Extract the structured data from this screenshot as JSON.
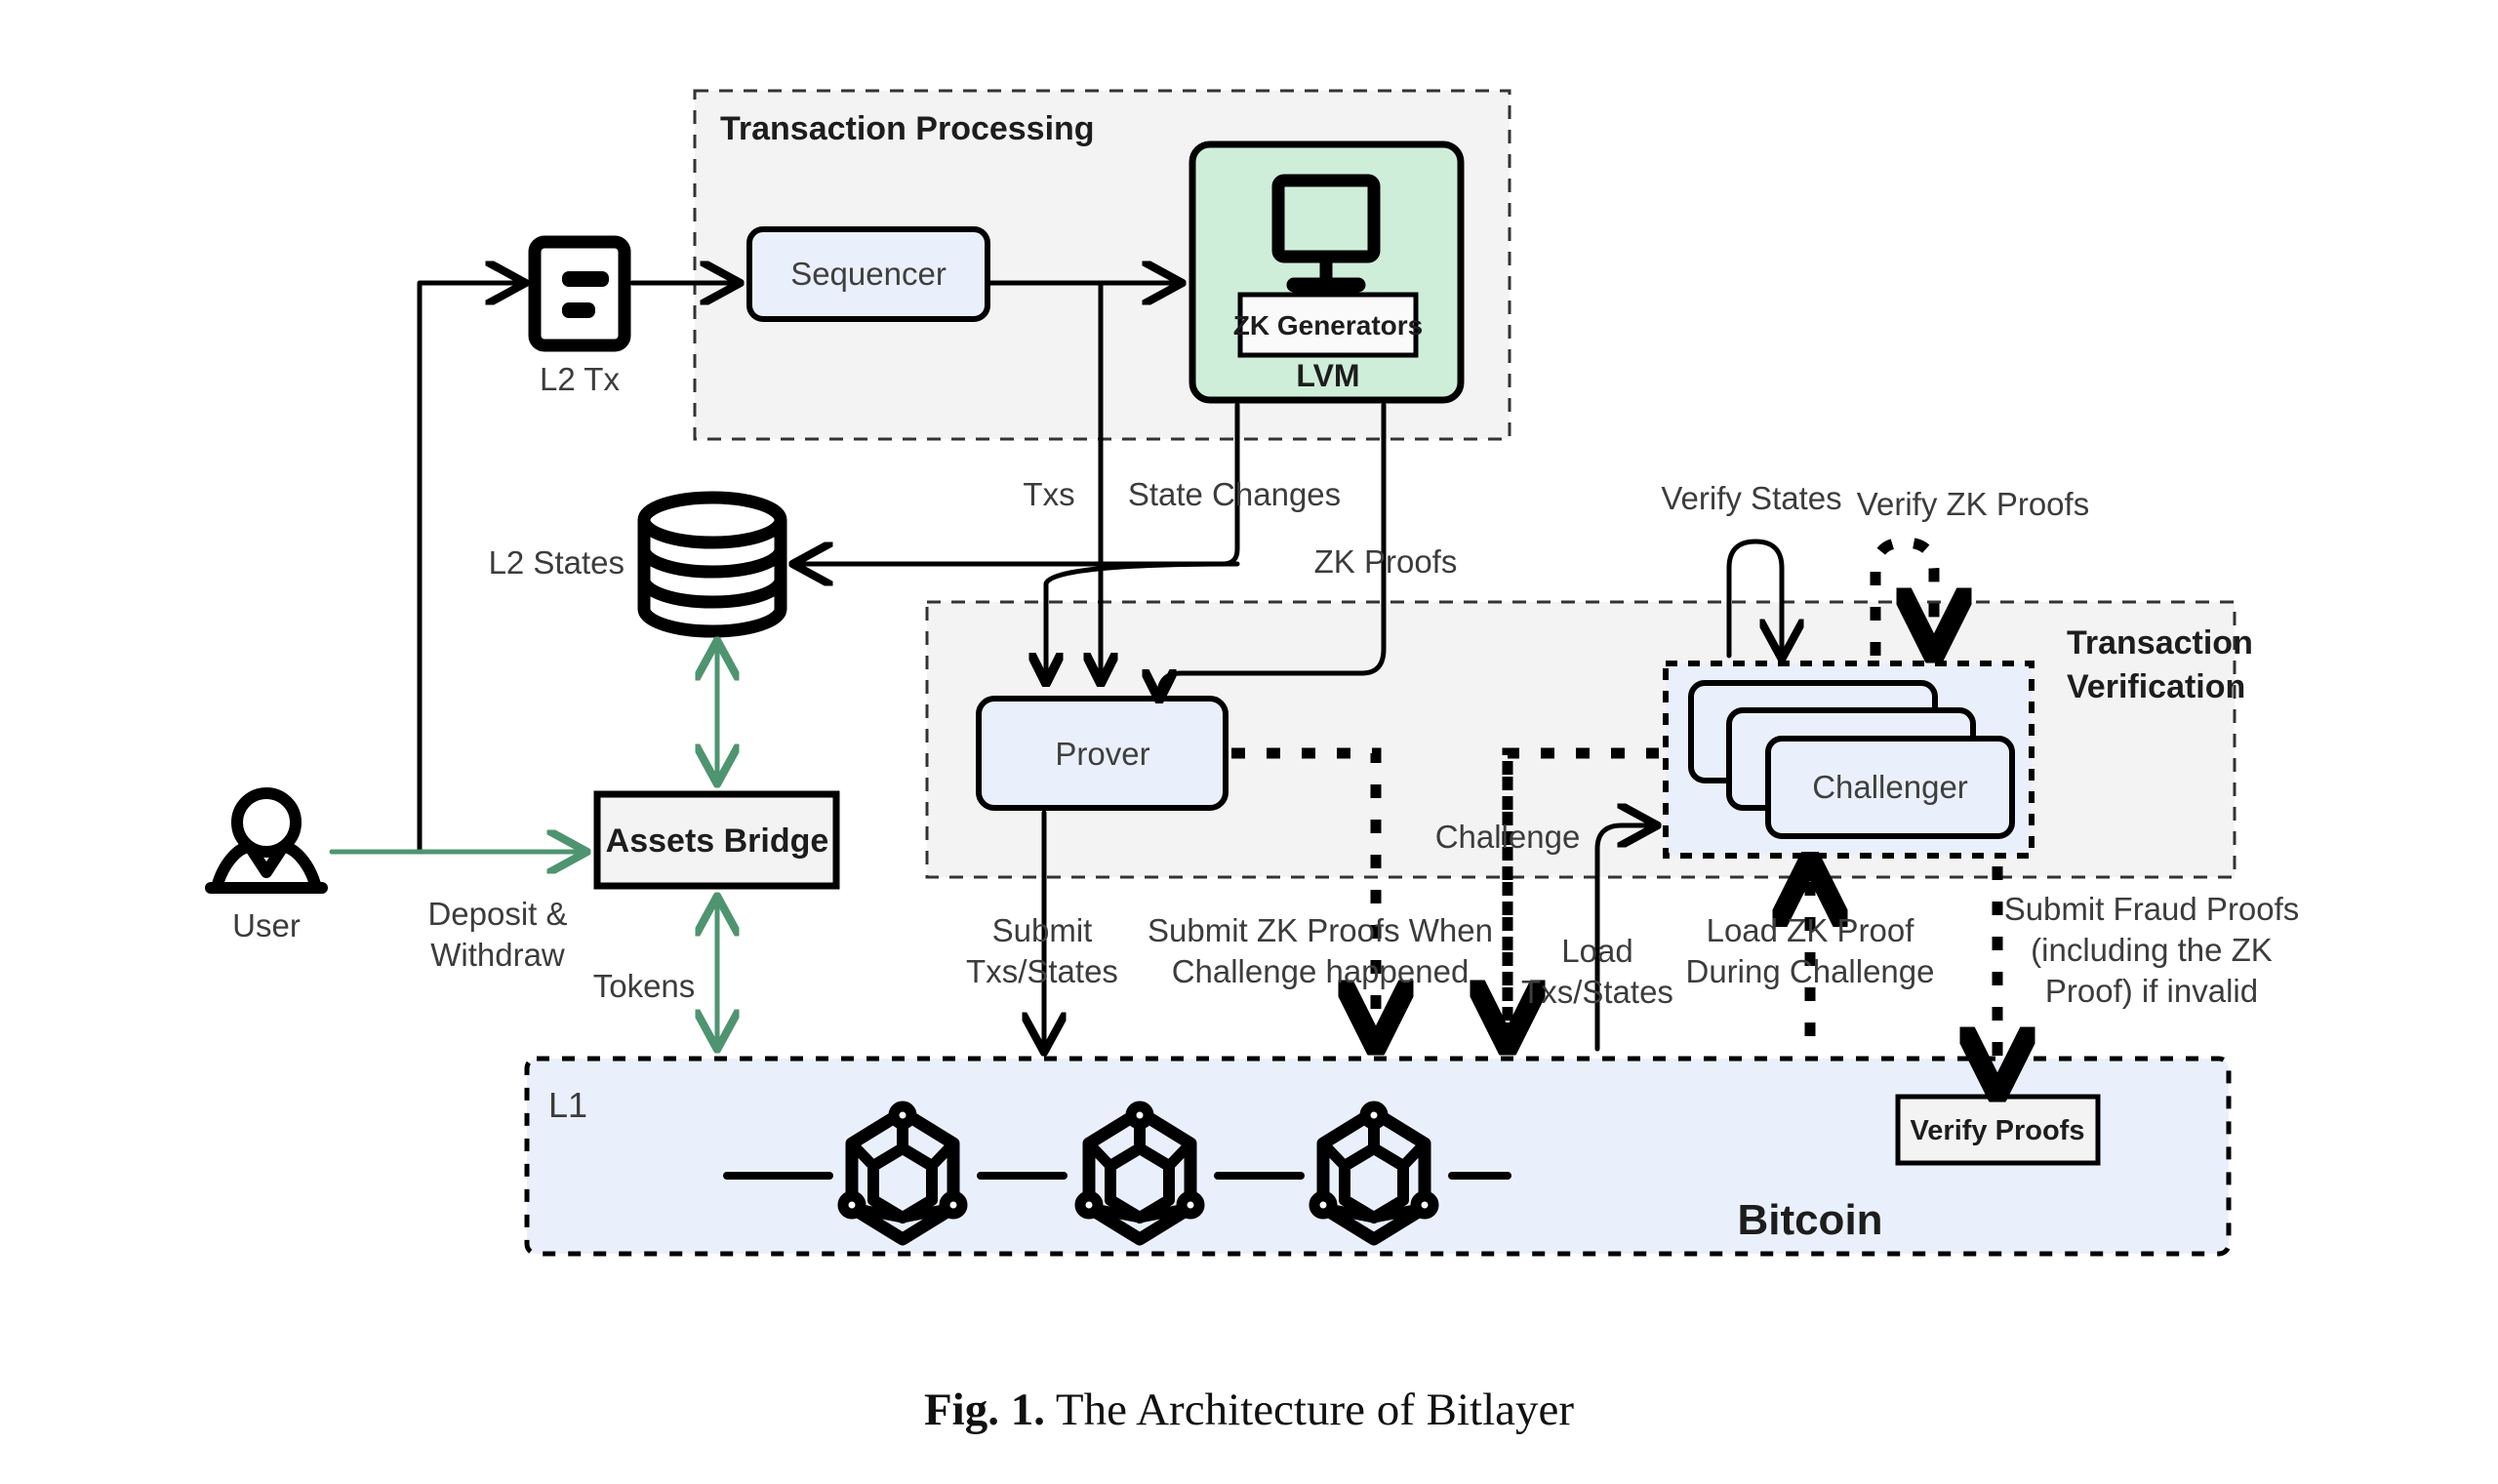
{
  "figure": {
    "caption_prefix": "Fig. 1.",
    "caption_text": "The Architecture of Bitlayer"
  },
  "colors": {
    "stroke": "#000000",
    "green_arrow": "#4f9470",
    "blue_fill": "#eaf0fb",
    "green_fill": "#cfeeda",
    "gray_fill": "#f2f2f2",
    "text": "#3c3c3c"
  },
  "containers": {
    "transaction_processing": {
      "label": "Transaction Processing"
    },
    "transaction_verification": {
      "label_line1": "Transaction",
      "label_line2": "Verification"
    },
    "l1": {
      "label": "L1",
      "chain_label": "Bitcoin"
    }
  },
  "nodes": {
    "l2tx": {
      "label": "L2 Tx",
      "icon": "document-icon"
    },
    "sequencer": {
      "label": "Sequencer"
    },
    "lvm": {
      "label": "LVM",
      "inner_label": "ZK Generators",
      "icon": "monitor-icon"
    },
    "l2states": {
      "label": "L2 States",
      "icon": "database-icon"
    },
    "user": {
      "label": "User",
      "icon": "user-icon"
    },
    "assets_bridge": {
      "label": "Assets Bridge"
    },
    "prover": {
      "label": "Prover"
    },
    "challenger": {
      "label": "Challenger"
    },
    "verify_proofs": {
      "label": "Verify Proofs"
    }
  },
  "edge_labels": {
    "deposit_withdraw_line1": "Deposit &",
    "deposit_withdraw_line2": "Withdraw",
    "tokens": "Tokens",
    "txs": "Txs",
    "state_changes": "State Changes",
    "zk_proofs": "ZK Proofs",
    "verify_states": "Verify States",
    "verify_zk_proofs": "Verify ZK Proofs",
    "challenge": "Challenge",
    "submit_txs_states_line1": "Submit",
    "submit_txs_states_line2": "Txs/States",
    "submit_zk_when_line1": "Submit ZK Proofs When",
    "submit_zk_when_line2": "Challenge happened",
    "load_txs_states_line1": "Load",
    "load_txs_states_line2": "Txs/States",
    "load_zk_proof_line1": "Load ZK Proof",
    "load_zk_proof_line2": "During Challenge",
    "fraud_line1": "Submit Fraud Proofs",
    "fraud_line2": "(including the ZK",
    "fraud_line3": "Proof) if invalid"
  }
}
